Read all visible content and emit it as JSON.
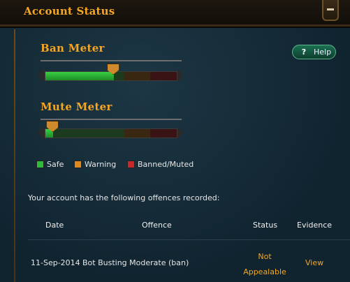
{
  "window": {
    "title": "Account Status"
  },
  "ban_meter": {
    "heading": "Ban Meter",
    "level": 0.52
  },
  "mute_meter": {
    "heading": "Mute Meter",
    "level": 0.06
  },
  "help_button": {
    "icon": "question-mark-icon",
    "label": "Help"
  },
  "legend": [
    {
      "label": "Safe",
      "color": "#2ebc3a"
    },
    {
      "label": "Warning",
      "color": "#e08a1e"
    },
    {
      "label": "Banned/Muted",
      "color": "#c9282a"
    }
  ],
  "offences": {
    "intro": "Your account has the following offences recorded:",
    "columns": {
      "date": "Date",
      "offence": "Offence",
      "status": "Status",
      "evidence": "Evidence"
    },
    "rows": [
      {
        "date": "11-Sep-2014",
        "offence": "Bot Busting Moderate (ban)",
        "status_line1": "Not",
        "status_line2": "Appealable",
        "evidence": "View"
      }
    ]
  },
  "colors": {
    "accent": "#f5a623",
    "background": "#102430"
  }
}
